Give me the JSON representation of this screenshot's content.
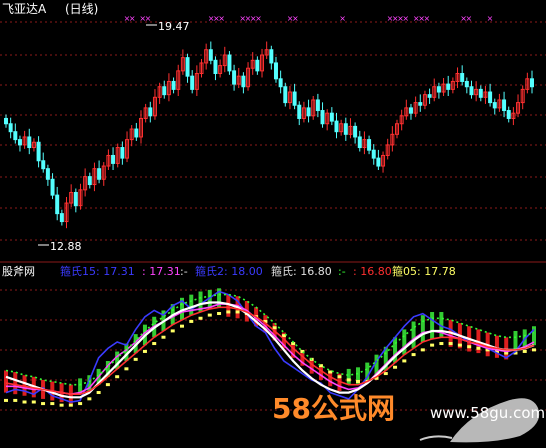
{
  "chart_data": [
    {
      "type": "candlestick",
      "title": "飞亚达A",
      "period": "(日线)",
      "annotations": [
        {
          "label": "19.47",
          "kind": "high"
        },
        {
          "label": "12.88",
          "kind": "low"
        }
      ],
      "ylim": [
        11.9,
        20.6
      ],
      "marker_color": "#ff44ff",
      "up_color": "#ff3030",
      "down_color": "#54ffff",
      "grid_color": "#8b1a1a",
      "marker_groups": [
        0.23,
        0.24,
        0.26,
        0.27,
        0.39,
        0.4,
        0.41,
        0.45,
        0.46,
        0.47,
        0.48,
        0.54,
        0.55,
        0.64,
        0.73,
        0.74,
        0.75,
        0.76,
        0.78,
        0.79,
        0.8,
        0.87,
        0.88,
        0.92
      ],
      "close": [
        16.6,
        16.3,
        16.0,
        15.8,
        16.1,
        15.7,
        15.9,
        15.2,
        14.9,
        14.5,
        13.9,
        13.2,
        12.9,
        13.6,
        14.0,
        13.5,
        14.1,
        14.6,
        14.3,
        14.9,
        14.5,
        15.0,
        15.4,
        15.1,
        15.7,
        15.3,
        16.0,
        16.4,
        16.1,
        16.8,
        17.2,
        16.9,
        17.6,
        18.0,
        17.7,
        18.2,
        17.9,
        18.6,
        19.1,
        18.4,
        17.9,
        18.5,
        18.9,
        19.4,
        19.0,
        18.5,
        18.8,
        19.2,
        18.6,
        18.1,
        18.4,
        18.0,
        18.7,
        19.0,
        18.6,
        19.2,
        19.4,
        18.9,
        18.3,
        18.0,
        17.4,
        17.8,
        17.3,
        16.8,
        17.2,
        16.9,
        17.5,
        17.1,
        16.6,
        17.0,
        16.7,
        16.3,
        16.6,
        16.2,
        16.5,
        16.1,
        15.7,
        16.0,
        15.6,
        15.3,
        15.0,
        15.4,
        15.8,
        16.2,
        16.6,
        16.9,
        17.2,
        17.0,
        17.4,
        17.3,
        17.7,
        17.6,
        18.0,
        17.8,
        18.1,
        17.9,
        18.2,
        18.5,
        18.2,
        18.0,
        17.7,
        17.9,
        17.6,
        17.8,
        17.4,
        17.2,
        17.5,
        17.1,
        16.8,
        17.0,
        17.4,
        17.9,
        18.3,
        18.0
      ]
    },
    {
      "type": "line",
      "title": "股斧网",
      "legend": [
        {
          "label": "箍氏15: 17.31",
          "color": "#3b3bff"
        },
        {
          "label": ": 17.31",
          "color": "#ff44ff"
        },
        {
          "label": ":-",
          "color": "#e0e0e0"
        },
        {
          "label": "箍氏2: 18.00",
          "color": "#3b3bff"
        },
        {
          "label": "箍氏: 16.80",
          "color": "#e0e0e0"
        },
        {
          "label": ":-",
          "color": "#33ff33"
        },
        {
          "label": ": 16.80",
          "color": "#ff3030"
        },
        {
          "label": "箍05: 17.78",
          "color": "#ffff66"
        }
      ],
      "series": [
        {
          "name": "箍氏15",
          "color": "#3b3bff",
          "values": [
            30,
            32,
            31,
            29,
            33,
            28,
            26,
            24,
            25,
            38,
            52,
            58,
            62,
            60,
            70,
            78,
            82,
            79,
            85,
            88,
            83,
            86,
            90,
            94,
            92,
            88,
            80,
            72,
            68,
            58,
            50,
            46,
            42,
            38,
            36,
            30,
            28,
            26,
            32,
            40,
            50,
            58,
            65,
            72,
            78,
            80,
            76,
            72,
            70,
            66,
            62,
            60,
            58,
            55,
            52,
            56,
            64,
            70
          ]
        },
        {
          "name": "",
          "color": "#ff44ff",
          "values": [
            34,
            34,
            33,
            32,
            32,
            31,
            30,
            29,
            30,
            33,
            40,
            47,
            53,
            57,
            62,
            68,
            72,
            75,
            78,
            81,
            82,
            83,
            84,
            86,
            86,
            85,
            82,
            77,
            72,
            66,
            60,
            54,
            49,
            45,
            41,
            37,
            34,
            32,
            33,
            36,
            42,
            48,
            54,
            59,
            64,
            68,
            69,
            68,
            66,
            64,
            62,
            60,
            58,
            57,
            56,
            57,
            59,
            62
          ]
        },
        {
          "name": "箍氏2",
          "color": "#ffff66",
          "values": [
            26,
            26,
            25,
            25,
            24,
            24,
            23,
            23,
            24,
            27,
            31,
            36,
            41,
            46,
            52,
            57,
            62,
            66,
            70,
            73,
            76,
            78,
            80,
            81,
            82,
            82,
            81,
            79,
            76,
            72,
            67,
            62,
            57,
            52,
            48,
            44,
            41,
            39,
            38,
            38,
            40,
            43,
            47,
            51,
            55,
            58,
            61,
            62,
            62,
            61,
            60,
            59,
            58,
            57,
            56,
            56,
            57,
            58
          ]
        },
        {
          "name": "箍氏",
          "color": "#ffffff",
          "values": [
            40,
            38,
            36,
            34,
            32,
            30,
            28,
            27,
            27,
            30,
            36,
            42,
            48,
            54,
            60,
            66,
            71,
            75,
            79,
            82,
            84,
            86,
            87,
            87,
            86,
            84,
            80,
            75,
            70,
            64,
            57,
            50,
            44,
            39,
            35,
            32,
            30,
            30,
            32,
            36,
            41,
            47,
            53,
            58,
            63,
            67,
            69,
            69,
            68,
            66,
            64,
            62,
            60,
            58,
            57,
            57,
            58,
            60
          ]
        },
        {
          "name": "",
          "color": "#33ff33",
          "values": [
            44,
            43,
            41,
            40,
            38,
            37,
            36,
            35,
            35,
            37,
            41,
            46,
            52,
            57,
            63,
            69,
            74,
            78,
            82,
            86,
            88,
            90,
            91,
            92,
            92,
            91,
            88,
            84,
            79,
            74,
            68,
            62,
            56,
            51,
            47,
            44,
            42,
            41,
            42,
            45,
            50,
            55,
            61,
            66,
            71,
            75,
            77,
            77,
            76,
            74,
            72,
            70,
            68,
            66,
            65,
            65,
            66,
            68
          ]
        },
        {
          "name": "箍05",
          "color": "#ff3030",
          "values": [
            36,
            35,
            34,
            33,
            32,
            31,
            30,
            29,
            29,
            31,
            35,
            40,
            45,
            50,
            55,
            60,
            65,
            69,
            73,
            76,
            79,
            81,
            83,
            84,
            84,
            83,
            81,
            78,
            74,
            69,
            64,
            58,
            53,
            48,
            44,
            40,
            37,
            35,
            35,
            37,
            40,
            44,
            49,
            54,
            58,
            62,
            64,
            65,
            65,
            64,
            62,
            61,
            59,
            58,
            57,
            57,
            58,
            60
          ]
        }
      ],
      "ylim": [
        0,
        100
      ]
    }
  ],
  "watermark": {
    "brand": "58公式网",
    "url": "www.58gu.com"
  }
}
